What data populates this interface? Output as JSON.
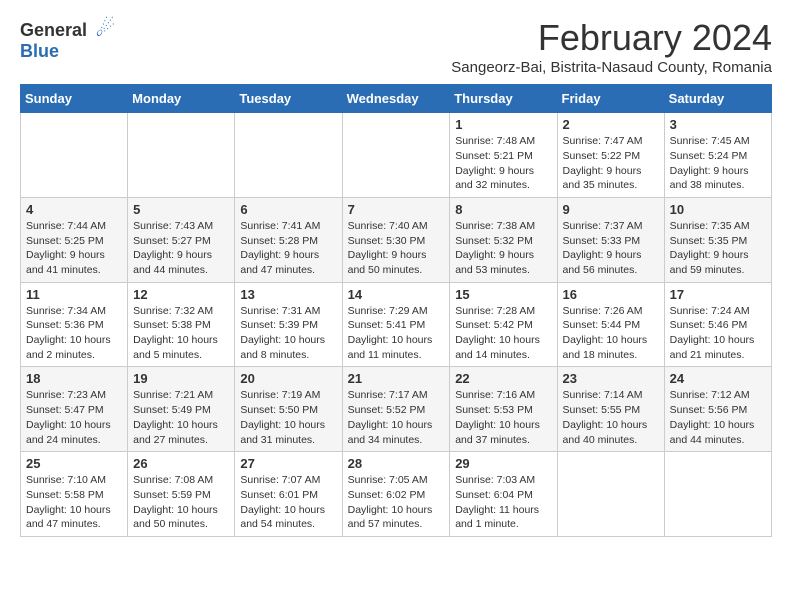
{
  "logo": {
    "general": "General",
    "blue": "Blue"
  },
  "header": {
    "month": "February 2024",
    "location": "Sangeorz-Bai, Bistrita-Nasaud County, Romania"
  },
  "days_of_week": [
    "Sunday",
    "Monday",
    "Tuesday",
    "Wednesday",
    "Thursday",
    "Friday",
    "Saturday"
  ],
  "weeks": [
    [
      {
        "day": "",
        "info": ""
      },
      {
        "day": "",
        "info": ""
      },
      {
        "day": "",
        "info": ""
      },
      {
        "day": "",
        "info": ""
      },
      {
        "day": "1",
        "info": "Sunrise: 7:48 AM\nSunset: 5:21 PM\nDaylight: 9 hours and 32 minutes."
      },
      {
        "day": "2",
        "info": "Sunrise: 7:47 AM\nSunset: 5:22 PM\nDaylight: 9 hours and 35 minutes."
      },
      {
        "day": "3",
        "info": "Sunrise: 7:45 AM\nSunset: 5:24 PM\nDaylight: 9 hours and 38 minutes."
      }
    ],
    [
      {
        "day": "4",
        "info": "Sunrise: 7:44 AM\nSunset: 5:25 PM\nDaylight: 9 hours and 41 minutes."
      },
      {
        "day": "5",
        "info": "Sunrise: 7:43 AM\nSunset: 5:27 PM\nDaylight: 9 hours and 44 minutes."
      },
      {
        "day": "6",
        "info": "Sunrise: 7:41 AM\nSunset: 5:28 PM\nDaylight: 9 hours and 47 minutes."
      },
      {
        "day": "7",
        "info": "Sunrise: 7:40 AM\nSunset: 5:30 PM\nDaylight: 9 hours and 50 minutes."
      },
      {
        "day": "8",
        "info": "Sunrise: 7:38 AM\nSunset: 5:32 PM\nDaylight: 9 hours and 53 minutes."
      },
      {
        "day": "9",
        "info": "Sunrise: 7:37 AM\nSunset: 5:33 PM\nDaylight: 9 hours and 56 minutes."
      },
      {
        "day": "10",
        "info": "Sunrise: 7:35 AM\nSunset: 5:35 PM\nDaylight: 9 hours and 59 minutes."
      }
    ],
    [
      {
        "day": "11",
        "info": "Sunrise: 7:34 AM\nSunset: 5:36 PM\nDaylight: 10 hours and 2 minutes."
      },
      {
        "day": "12",
        "info": "Sunrise: 7:32 AM\nSunset: 5:38 PM\nDaylight: 10 hours and 5 minutes."
      },
      {
        "day": "13",
        "info": "Sunrise: 7:31 AM\nSunset: 5:39 PM\nDaylight: 10 hours and 8 minutes."
      },
      {
        "day": "14",
        "info": "Sunrise: 7:29 AM\nSunset: 5:41 PM\nDaylight: 10 hours and 11 minutes."
      },
      {
        "day": "15",
        "info": "Sunrise: 7:28 AM\nSunset: 5:42 PM\nDaylight: 10 hours and 14 minutes."
      },
      {
        "day": "16",
        "info": "Sunrise: 7:26 AM\nSunset: 5:44 PM\nDaylight: 10 hours and 18 minutes."
      },
      {
        "day": "17",
        "info": "Sunrise: 7:24 AM\nSunset: 5:46 PM\nDaylight: 10 hours and 21 minutes."
      }
    ],
    [
      {
        "day": "18",
        "info": "Sunrise: 7:23 AM\nSunset: 5:47 PM\nDaylight: 10 hours and 24 minutes."
      },
      {
        "day": "19",
        "info": "Sunrise: 7:21 AM\nSunset: 5:49 PM\nDaylight: 10 hours and 27 minutes."
      },
      {
        "day": "20",
        "info": "Sunrise: 7:19 AM\nSunset: 5:50 PM\nDaylight: 10 hours and 31 minutes."
      },
      {
        "day": "21",
        "info": "Sunrise: 7:17 AM\nSunset: 5:52 PM\nDaylight: 10 hours and 34 minutes."
      },
      {
        "day": "22",
        "info": "Sunrise: 7:16 AM\nSunset: 5:53 PM\nDaylight: 10 hours and 37 minutes."
      },
      {
        "day": "23",
        "info": "Sunrise: 7:14 AM\nSunset: 5:55 PM\nDaylight: 10 hours and 40 minutes."
      },
      {
        "day": "24",
        "info": "Sunrise: 7:12 AM\nSunset: 5:56 PM\nDaylight: 10 hours and 44 minutes."
      }
    ],
    [
      {
        "day": "25",
        "info": "Sunrise: 7:10 AM\nSunset: 5:58 PM\nDaylight: 10 hours and 47 minutes."
      },
      {
        "day": "26",
        "info": "Sunrise: 7:08 AM\nSunset: 5:59 PM\nDaylight: 10 hours and 50 minutes."
      },
      {
        "day": "27",
        "info": "Sunrise: 7:07 AM\nSunset: 6:01 PM\nDaylight: 10 hours and 54 minutes."
      },
      {
        "day": "28",
        "info": "Sunrise: 7:05 AM\nSunset: 6:02 PM\nDaylight: 10 hours and 57 minutes."
      },
      {
        "day": "29",
        "info": "Sunrise: 7:03 AM\nSunset: 6:04 PM\nDaylight: 11 hours and 1 minute."
      },
      {
        "day": "",
        "info": ""
      },
      {
        "day": "",
        "info": ""
      }
    ]
  ]
}
